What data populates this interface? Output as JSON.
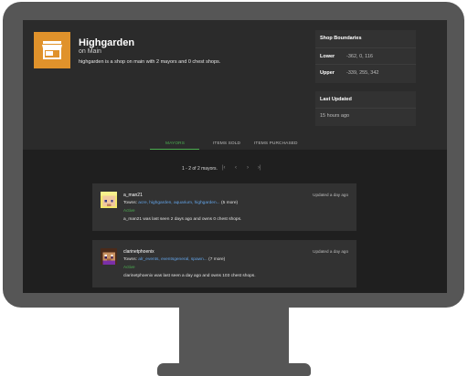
{
  "shop": {
    "title": "Highgarden",
    "subtitle": "on Main",
    "description": "highgarden is a shop on main with 2 mayors and 0 chest shops.",
    "icon": "store-icon",
    "icon_color": "#e0922b"
  },
  "boundaries": {
    "title": "Shop Boundaries",
    "lower_label": "Lower",
    "lower_value": "-362, 0, 116",
    "upper_label": "Upper",
    "upper_value": "-339, 255, 342"
  },
  "last_updated": {
    "title": "Last Updated",
    "value": "15 hours ago"
  },
  "tabs": [
    {
      "label": "MAYORS",
      "active": true
    },
    {
      "label": "ITEMS SOLD",
      "active": false
    },
    {
      "label": "ITEMS PURCHASED",
      "active": false
    }
  ],
  "pagination": {
    "summary": "1 - 2 of 2 mayors.",
    "first_icon": "first-page-icon",
    "prev_icon": "prev-page-icon",
    "next_icon": "next-page-icon",
    "last_icon": "last-page-icon"
  },
  "mayors": [
    {
      "name": "a_man21",
      "towns_label": "Towns:",
      "towns_links": "acre, highgarden, aquarium, highgarden...",
      "towns_more": "(5 more)",
      "status": "Active",
      "summary": "a_man21 was last seen 2 days ago and owns 0 chest shops.",
      "updated": "Updated a day ago"
    },
    {
      "name": "clarinetphoenix",
      "towns_label": "Towns:",
      "towns_links": "alr_events, eventsgeneral, spawn...",
      "towns_more": "(7 more)",
      "status": "Active",
      "summary": "clarinetphoenix was last seen a day ago and owns 103 chest shops.",
      "updated": "Updated a day ago"
    }
  ],
  "colors": {
    "accent": "#4caf50",
    "link": "#63a4e8",
    "background": "#2b2b2b",
    "content_background": "#1f1f1f",
    "panel": "#323232"
  }
}
